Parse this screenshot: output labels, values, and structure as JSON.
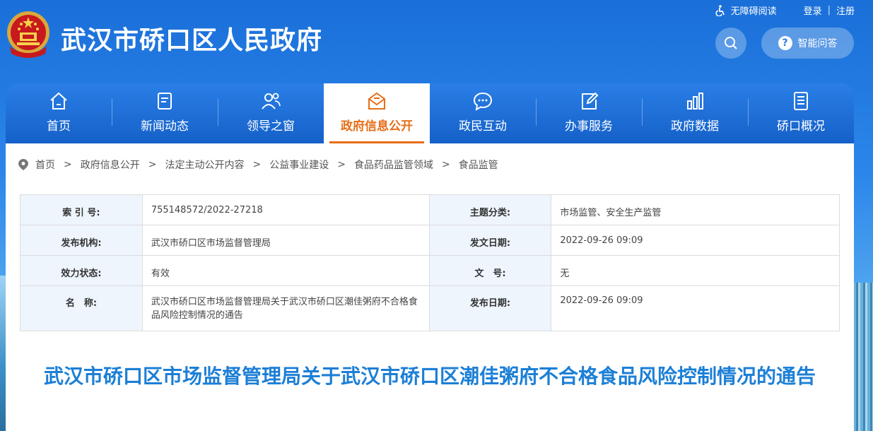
{
  "header": {
    "site_title": "武汉市硚口区人民政府",
    "accessibility": "无障碍阅读",
    "login": "登录",
    "separator": "|",
    "register": "注册",
    "qa_label": "智能问答",
    "search_icon": "search-icon"
  },
  "nav": {
    "items": [
      {
        "label": "首页",
        "icon": "home-icon"
      },
      {
        "label": "新闻动态",
        "icon": "news-icon"
      },
      {
        "label": "领导之窗",
        "icon": "leaders-icon"
      },
      {
        "label": "政府信息公开",
        "icon": "mail-icon",
        "active": true
      },
      {
        "label": "政民互动",
        "icon": "chat-icon"
      },
      {
        "label": "办事服务",
        "icon": "edit-icon"
      },
      {
        "label": "政府数据",
        "icon": "bar-chart-icon"
      },
      {
        "label": "硚口概况",
        "icon": "document-icon"
      }
    ],
    "active_color": "#e76e18"
  },
  "breadcrumb": {
    "items": [
      "首页",
      "政府信息公开",
      "法定主动公开内容",
      "公益事业建设",
      "食品药品监管领域",
      "食品监管"
    ],
    "sep": ">"
  },
  "meta": {
    "rows": [
      {
        "k1": "索 引 号:",
        "v1": "755148572/2022-27218",
        "k2": "主题分类:",
        "v2": "市场监管、安全生产监管"
      },
      {
        "k1": "发布机构:",
        "v1": "武汉市硚口区市场监督管理局",
        "k2": "发文日期:",
        "v2": "2022-09-26 09:09"
      },
      {
        "k1": "效力状态:",
        "v1": "有效",
        "k2": "文　号:",
        "v2": "无"
      },
      {
        "k1": "名　称:",
        "v1": "武汉市硚口区市场监督管理局关于武汉市硚口区潮佳粥府不合格食品风险控制情况的通告",
        "k2": "发布日期:",
        "v2": "2022-09-26 09:09"
      }
    ]
  },
  "article": {
    "title": "武汉市硚口区市场监督管理局关于武汉市硚口区潮佳粥府不合格食品风险控制情况的通告"
  },
  "colors": {
    "brand_blue": "#1560c9",
    "title_blue": "#1c7fd6",
    "table_key_bg": "#eef5fd"
  }
}
